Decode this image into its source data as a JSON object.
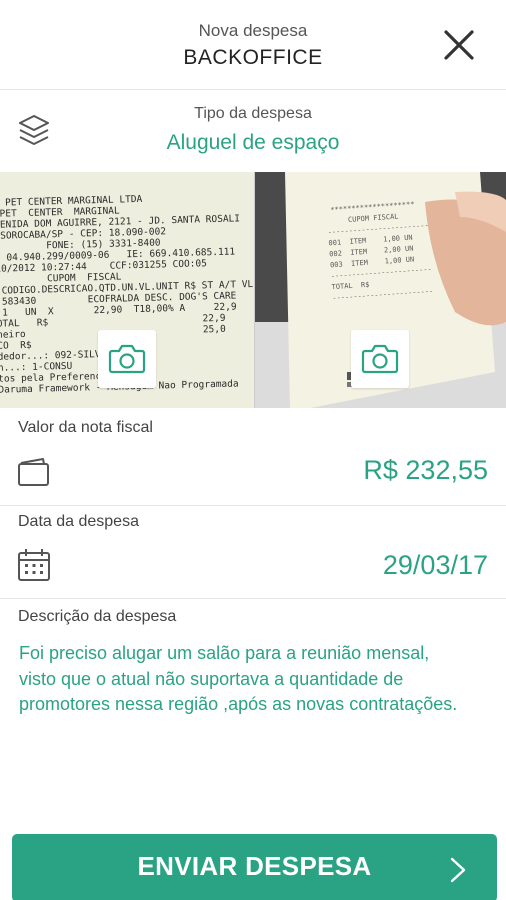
{
  "header": {
    "subtitle": "Nova despesa",
    "title": "BACKOFFICE",
    "close_icon": "close-icon"
  },
  "expense_type": {
    "icon": "layers-icon",
    "label": "Tipo da despesa",
    "value": "Aluguel de espaço"
  },
  "photos": {
    "left_receipt_text": "  PET CENTER MARGINAL LTDA\n PET  CENTER  MARGINAL\nMENIDA DOM AGUIRRE, 2121 - JD. SANTA ROSALI\n SOROCABA/SP - CEP: 18.090-002\n         FONE: (15) 3331-8400\n: 04.940.299/0009-06   IE: 669.410.685.111\n10/2012 10:27:44    CCF:031255 COO:05\n         CUPOM  FISCAL\n.CODIGO.DESCRICAO.QTD.UN.VL.UNIT R$ ST A/T VL ITEM\n 583430         ECOFRALDA DESC. DOG'S CARE\n 1   UN  X       22,90  T18,00% A     22,9\nOTAL   R$                           22,9\nheiro                               25,0\nCO  R$\ndedor...: 092-SILV\nn...: 1-CONSU\ntos pela Preferencia\nDaruma Framework - Mensagem Nao Programada",
    "right_receipt_text": "  ********************\n      CUPOM FISCAL\n ------------------------\n 001  ITEM    1,00 UN\n 002  ITEM    2,00 UN\n 003  ITEM    1,00 UN\n ------------------------\n TOTAL  R$\n ------------------------",
    "camera_icon": "camera-icon"
  },
  "invoice": {
    "label": "Valor da nota fiscal",
    "icon": "wallet-icon",
    "value": "R$ 232,55"
  },
  "date": {
    "label": "Data da despesa",
    "icon": "calendar-icon",
    "value": "29/03/17"
  },
  "description": {
    "label": "Descrição da despesa",
    "text": "Foi preciso alugar um salão para a reunião mensal, visto que o atual não suportava a quantidade de promotores nessa região ,após as novas contratações."
  },
  "submit": {
    "label": "ENVIAR DESPESA",
    "icon": "chevron-right-icon"
  },
  "colors": {
    "accent": "#2aa384",
    "text": "#444444",
    "divider": "#e6e6e6"
  }
}
